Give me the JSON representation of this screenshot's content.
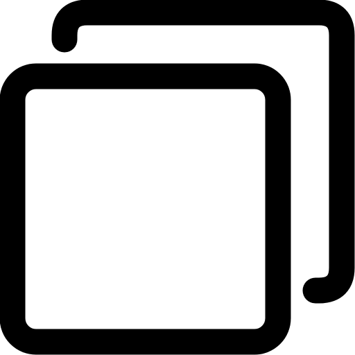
{
  "icon": {
    "name": "copy-icon",
    "stroke_color": "#000000",
    "background_color": "#ffffff"
  }
}
